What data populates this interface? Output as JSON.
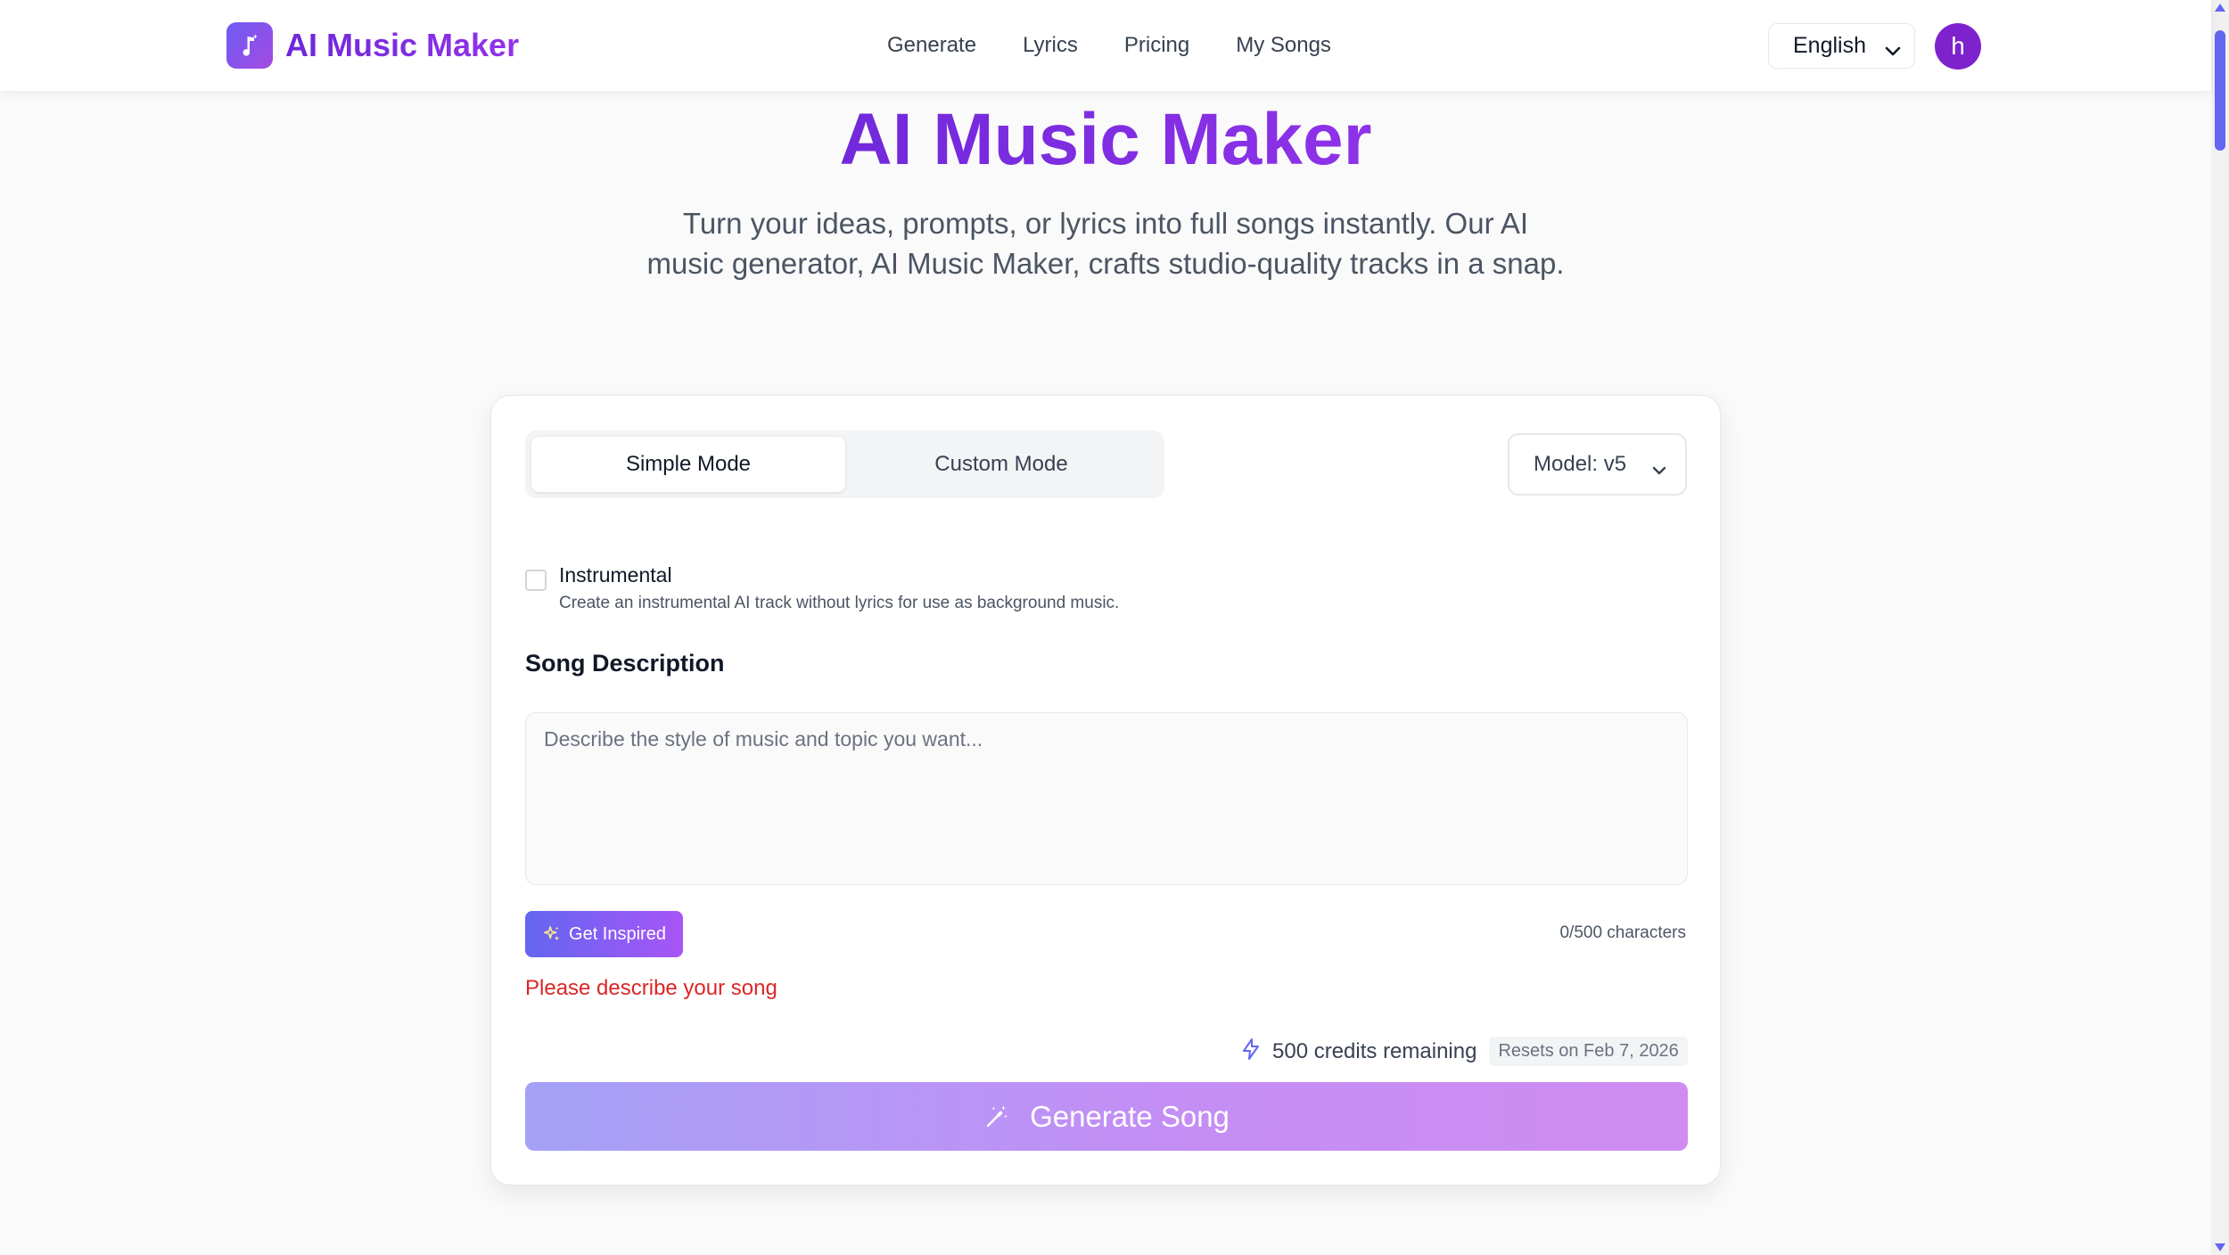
{
  "brand": {
    "name": "AI Music Maker",
    "logo_icon": "music-note-icon"
  },
  "nav": {
    "items": [
      "Generate",
      "Lyrics",
      "Pricing",
      "My Songs"
    ]
  },
  "language": {
    "selected": "English"
  },
  "user": {
    "avatar_letter": "h",
    "avatar_color": "#7e22ce"
  },
  "hero": {
    "title": "AI Music Maker",
    "subtitle": "Turn your ideas, prompts, or lyrics into full songs instantly. Our AI music generator, AI Music Maker, crafts studio-quality tracks in a snap."
  },
  "form": {
    "modes": [
      "Simple Mode",
      "Custom Mode"
    ],
    "active_mode": "Simple Mode",
    "model_label": "Model: v5",
    "instrumental": {
      "label": "Instrumental",
      "help": "Create an instrumental AI track without lyrics for use as background music.",
      "checked": false
    },
    "description_title": "Song Description",
    "description_value": "",
    "description_placeholder": "Describe the style of music and topic you want...",
    "inspire_label": "Get Inspired",
    "char_count": "0/500 characters",
    "error": "Please describe your song",
    "credits": "500 credits remaining",
    "reset": "Resets on Feb 7, 2026",
    "generate_label": "Generate Song"
  },
  "colors": {
    "brand": "#7c3aed",
    "accent_gradient_start": "#6366f1",
    "accent_gradient_end": "#a855f7",
    "error": "#dc2626",
    "scrollbar": "#6366f1"
  }
}
